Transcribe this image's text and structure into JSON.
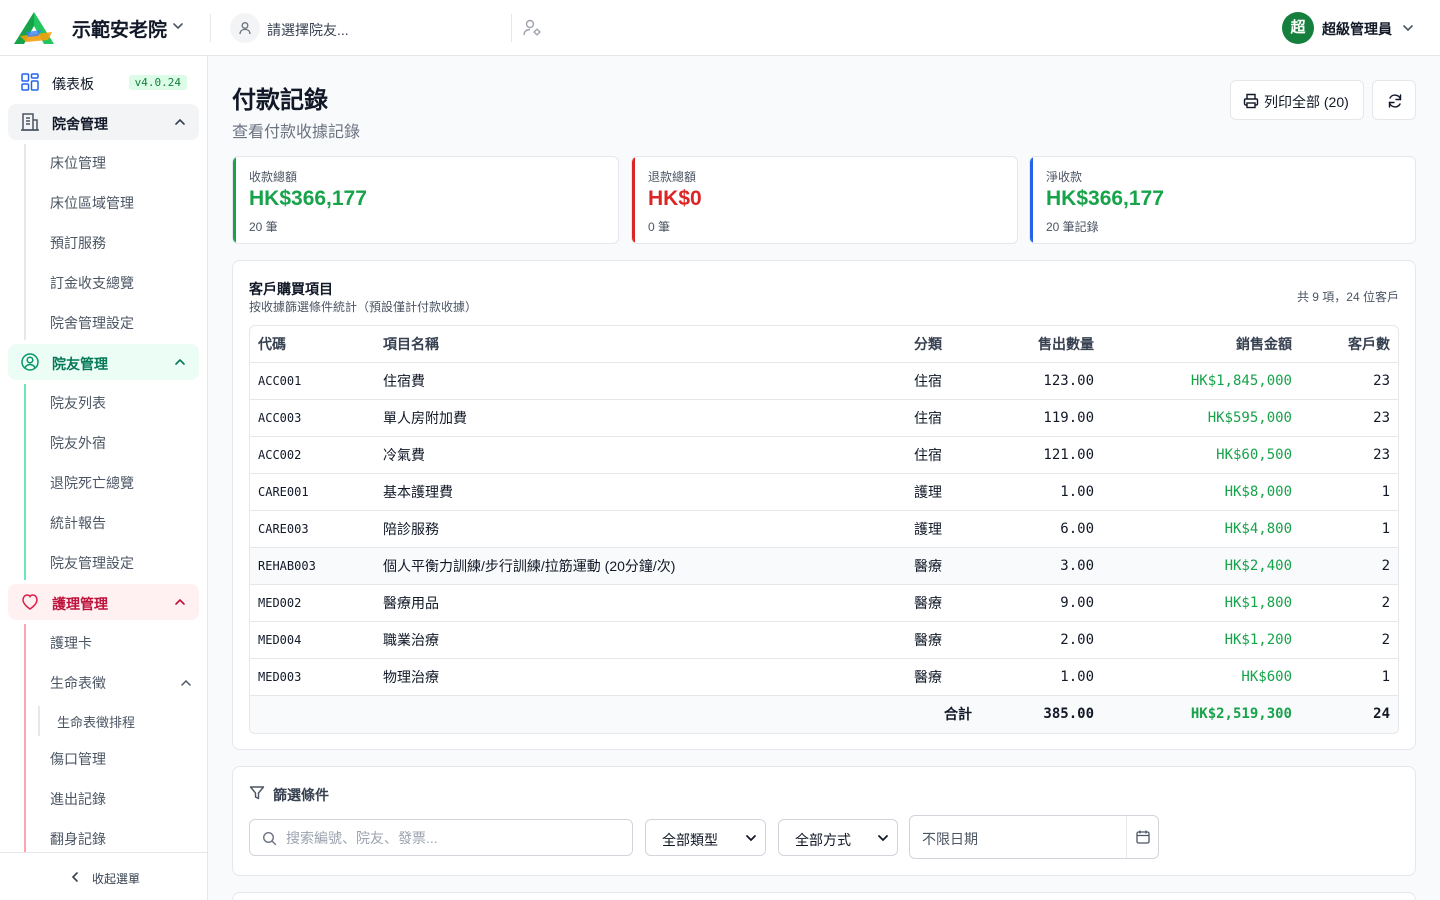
{
  "header": {
    "facility_name": "示範安老院",
    "resident_placeholder": "請選擇院友...",
    "user_initial": "超",
    "user_name": "超級管理員",
    "brand_color": "#15803d"
  },
  "sidebar": {
    "dashboard": "儀表板",
    "version": "v4.0.24",
    "groups": [
      {
        "label": "院舍管理",
        "color": "#4b5563",
        "items": [
          "床位管理",
          "床位區域管理",
          "預訂服務",
          "訂金收支總覽",
          "院舍管理設定"
        ]
      },
      {
        "label": "院友管理",
        "color": "#059669",
        "items": [
          "院友列表",
          "院友外宿",
          "退院死亡總覽",
          "統計報告",
          "院友管理設定"
        ]
      },
      {
        "label": "護理管理",
        "color": "#be123c",
        "items": [
          "護理卡",
          "生命表徵",
          "生命表徵排程",
          "傷口管理",
          "進出記錄",
          "翻身記錄"
        ]
      }
    ],
    "collapse_label": "收起選單"
  },
  "page": {
    "title": "付款記錄",
    "subtitle": "查看付款收據記錄",
    "print_all_label": "列印全部 (20)"
  },
  "stats": [
    {
      "label": "收款總額",
      "value": "HK$366,177",
      "sub": "20 筆",
      "color": "#16a34a"
    },
    {
      "label": "退款總額",
      "value": "HK$0",
      "sub": "0 筆",
      "color": "#dc2626"
    },
    {
      "label": "淨收款",
      "value": "HK$366,177",
      "sub": "20 筆記錄",
      "color": "#16a34a"
    }
  ],
  "items": {
    "title": "客戶購買項目",
    "description": "按收據篩選條件統計（預設僅計付款收據）",
    "count": "共 9 項，24 位客戶",
    "columns": [
      "代碼",
      "項目名稱",
      "分類",
      "售出數量",
      "銷售金額",
      "客戶數"
    ],
    "rows": [
      [
        "ACC001",
        "住宿費",
        "住宿",
        "123.00",
        "HK$1,845,000",
        "23"
      ],
      [
        "ACC003",
        "單人房附加費",
        "住宿",
        "119.00",
        "HK$595,000",
        "23"
      ],
      [
        "ACC002",
        "冷氣費",
        "住宿",
        "121.00",
        "HK$60,500",
        "23"
      ],
      [
        "CARE001",
        "基本護理費",
        "護理",
        "1.00",
        "HK$8,000",
        "1"
      ],
      [
        "CARE003",
        "陪診服務",
        "護理",
        "6.00",
        "HK$4,800",
        "1"
      ],
      [
        "REHAB003",
        "個人平衡力訓練/步行訓練/拉筋運動 (20分鐘/次)",
        "醫療",
        "3.00",
        "HK$2,400",
        "2"
      ],
      [
        "MED002",
        "醫療用品",
        "醫療",
        "9.00",
        "HK$1,800",
        "2"
      ],
      [
        "MED004",
        "職業治療",
        "醫療",
        "2.00",
        "HK$1,200",
        "2"
      ],
      [
        "MED003",
        "物理治療",
        "醫療",
        "1.00",
        "HK$600",
        "1"
      ]
    ],
    "total": {
      "label": "合計",
      "qty": "385.00",
      "amount": "HK$2,519,300",
      "customers": "24"
    }
  },
  "filters": {
    "title": "篩選條件",
    "search_placeholder": "搜索編號、院友、發票...",
    "type_value": "全部類型",
    "method_value": "全部方式",
    "date_placeholder": "不限日期"
  }
}
